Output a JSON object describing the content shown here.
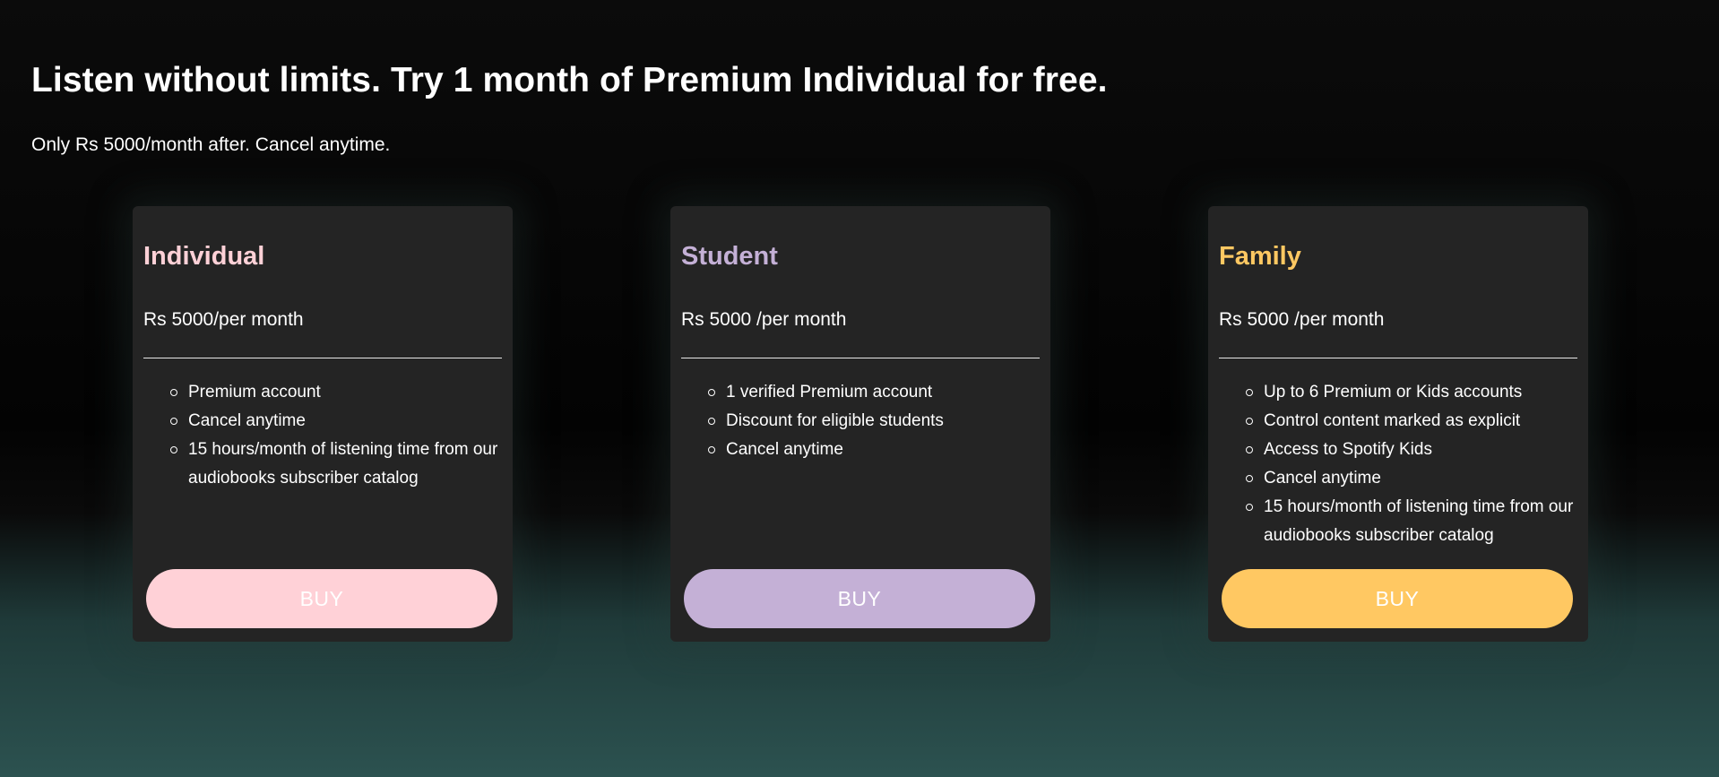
{
  "hero": {
    "headline": "Listen without limits. Try 1 month of Premium Individual for free.",
    "subline": "Only Rs 5000/month after. Cancel anytime."
  },
  "plans": [
    {
      "name": "Individual",
      "price": "Rs 5000/per month",
      "accent": "#ffd1d7",
      "features": [
        "Premium account",
        "Cancel anytime",
        "15 hours/month of listening time from our audiobooks subscriber catalog"
      ],
      "button_label": "BUY"
    },
    {
      "name": "Student",
      "price": "Rs 5000 /per month",
      "accent": "#c4b0d6",
      "features": [
        "1 verified Premium account",
        "Discount for eligible students",
        "Cancel anytime"
      ],
      "button_label": "BUY"
    },
    {
      "name": "Family",
      "price": "Rs 5000 /per month",
      "accent": "#ffc862",
      "features": [
        "Up to 6 Premium or Kids accounts",
        "Control content marked as explicit",
        "Access to Spotify Kids",
        "Cancel anytime",
        "15 hours/month of listening time from our audiobooks subscriber catalog"
      ],
      "button_label": "BUY"
    }
  ]
}
